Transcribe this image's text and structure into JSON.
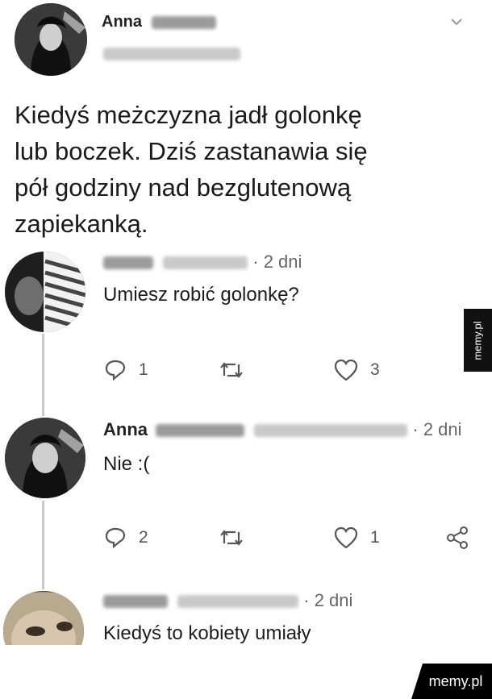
{
  "main_tweet": {
    "author_name": "Anna",
    "text_lines": [
      "Kiedyś meżczyzna jadł golonkę",
      "lub boczek. Dziś zastanawia się",
      "pół godziny nad bezglutenową",
      "zapiekanką."
    ]
  },
  "replies": [
    {
      "time": "· 2 dni",
      "text": "Umiesz robić golonkę?",
      "reply_count": "1",
      "like_count": "3"
    },
    {
      "author_name": "Anna",
      "time": "· 2 dni",
      "text": "Nie :(",
      "reply_count": "2",
      "like_count": "1"
    },
    {
      "time": "· 2 dni",
      "text": "Kiedyś to kobiety umiały"
    }
  ],
  "watermarks": {
    "side": "memy.pl",
    "bottom": "memy.pl"
  },
  "icons": [
    "chevron-down-icon",
    "reply-icon",
    "retweet-icon",
    "like-icon",
    "share-icon"
  ]
}
